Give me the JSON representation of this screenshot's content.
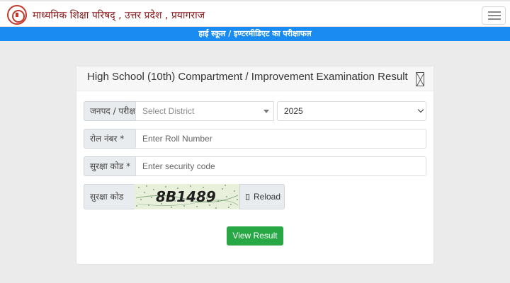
{
  "header": {
    "site_title": "माध्यमिक शिक्षा परिषद् , उत्तर प्रदेश , प्रयागराज",
    "menu_icon": "hamburger-menu-icon",
    "logo": "board-emblem-logo"
  },
  "banner": {
    "text": "हाई स्कूल / इण्टरमीडिएट का परीक्षाफल",
    "color": "#1a8bf0"
  },
  "form": {
    "title": "High School (10th) Compartment / Improvement Examination Result",
    "close_icon": "close-icon",
    "district_label": "जनपद / परीक्षा",
    "district_placeholder": "Select District",
    "year_value": "2025",
    "roll_label": "रोल नंबर *",
    "roll_placeholder": "Enter Roll Number",
    "security_label": "सुरक्षा कोड *",
    "security_placeholder": "Enter security code",
    "captcha_label": "सुरक्षा कोड",
    "captcha_text": "8B1489",
    "reload_label": "Reload",
    "reload_icon": "reload-icon",
    "submit_label": "View Result",
    "submit_color": "#28a745"
  }
}
